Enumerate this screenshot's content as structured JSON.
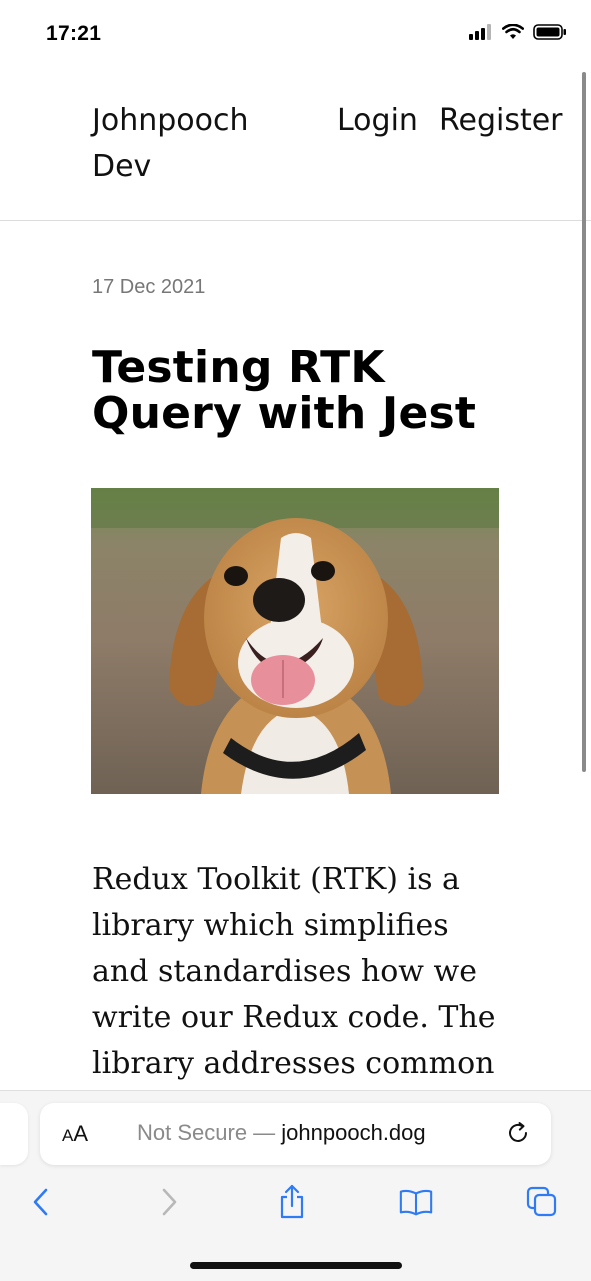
{
  "status_bar": {
    "time": "17:21",
    "icons": [
      "cellular-signal-icon",
      "wifi-icon",
      "battery-icon"
    ]
  },
  "header": {
    "brand": "Johnpooch Dev",
    "nav": {
      "login": "Login",
      "register": "Register"
    }
  },
  "post": {
    "date": "17 Dec 2021",
    "title": "Testing RTK Query with Jest",
    "image": "beagle-photo",
    "body": "Redux Toolkit (RTK) is a library which simplifies and standardises how we write our Redux code. The library addresses common redux"
  },
  "browser": {
    "aa_label_small": "A",
    "aa_label_large": "A",
    "url_prefix": "Not Secure — ",
    "url_domain": "johnpooch.dog",
    "toolbar_icons": [
      "back-icon",
      "forward-icon",
      "share-icon",
      "bookmarks-icon",
      "tabs-icon"
    ]
  },
  "colors": {
    "accent": "#2f7bf5",
    "disabled": "#b8b8b8",
    "muted_text": "#777777"
  }
}
